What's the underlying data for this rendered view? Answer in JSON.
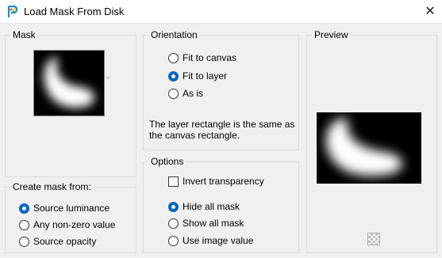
{
  "window": {
    "title": "Load Mask From Disk",
    "close_glyph": "✕"
  },
  "mask": {
    "label": "Mask"
  },
  "create_mask_from": {
    "label": "Create mask from:",
    "options": [
      {
        "label": "Source luminance",
        "checked": true
      },
      {
        "label": "Any non-zero value",
        "checked": false
      },
      {
        "label": "Source opacity",
        "checked": false
      }
    ]
  },
  "orientation": {
    "label": "Orientation",
    "options": [
      {
        "label": "Fit to canvas",
        "checked": false
      },
      {
        "label": "Fit to layer",
        "checked": true
      },
      {
        "label": "As is",
        "checked": false
      }
    ],
    "info_line1": "The layer rectangle is the same as",
    "info_line2": "the canvas rectangle."
  },
  "options": {
    "label": "Options",
    "invert_transparency": {
      "label": "Invert transparency",
      "checked": false
    },
    "radios": [
      {
        "label": "Hide all mask",
        "checked": true
      },
      {
        "label": "Show all mask",
        "checked": false
      },
      {
        "label": "Use image value",
        "checked": false
      }
    ]
  },
  "preview": {
    "label": "Preview"
  },
  "icons": {
    "app": "paint-shop-pro-icon",
    "close": "close-icon",
    "checker": "transparency-checkerboard-icon",
    "dropdown": "chevron-down-icon"
  },
  "colors": {
    "accent": "#0067c0",
    "background": "#f0f0f0"
  }
}
